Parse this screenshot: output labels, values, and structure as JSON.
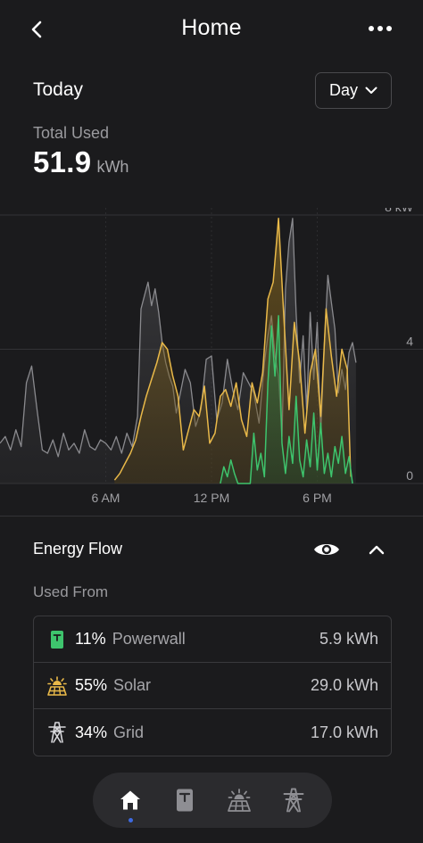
{
  "header": {
    "title": "Home"
  },
  "period": {
    "label": "Today",
    "selector_value": "Day"
  },
  "total": {
    "label": "Total Used",
    "value": "51.9",
    "unit": "kWh"
  },
  "chart_data": {
    "type": "area",
    "x_tick_labels": [
      "6 AM",
      "12 PM",
      "6 PM"
    ],
    "y_tick_labels": [
      "8 kW",
      "4",
      "0"
    ],
    "ylim": [
      0,
      8
    ],
    "xlim_hours": [
      0,
      24
    ],
    "grid": true,
    "colors": {
      "home": "#8a8a8e",
      "solar": "#e9b949",
      "powerwall": "#3ec46d"
    },
    "series": [
      {
        "key": "home",
        "x": [
          0,
          0.3,
          0.6,
          0.9,
          1.2,
          1.5,
          1.8,
          2.1,
          2.4,
          2.7,
          3.0,
          3.3,
          3.6,
          3.9,
          4.2,
          4.5,
          4.8,
          5.1,
          5.4,
          5.7,
          6.0,
          6.3,
          6.6,
          6.9,
          7.2,
          7.5,
          7.8,
          8.0,
          8.2,
          8.4,
          8.6,
          8.8,
          9.0,
          9.2,
          9.4,
          9.6,
          9.8,
          10.0,
          10.2,
          10.5,
          10.8,
          11.1,
          11.4,
          11.7,
          12.0,
          12.3,
          12.6,
          12.9,
          13.2,
          13.5,
          13.8,
          14.1,
          14.4,
          14.7,
          15.0,
          15.2,
          15.4,
          15.6,
          15.8,
          16.0,
          16.2,
          16.4,
          16.6,
          16.8,
          17.0,
          17.2,
          17.4,
          17.6,
          17.8,
          18.0,
          18.2,
          18.4,
          18.6,
          18.8,
          19.0,
          19.2,
          19.4,
          19.6,
          19.8,
          20.0,
          20.2
        ],
        "values": [
          1.2,
          1.4,
          1.0,
          1.6,
          1.1,
          3.0,
          3.5,
          2.2,
          1.0,
          0.9,
          1.3,
          0.8,
          1.5,
          1.0,
          1.2,
          0.9,
          1.6,
          1.1,
          1.0,
          1.3,
          1.2,
          1.0,
          1.4,
          0.9,
          1.5,
          1.1,
          2.0,
          5.2,
          5.6,
          6.0,
          5.3,
          5.8,
          5.1,
          4.2,
          3.6,
          3.2,
          2.9,
          2.1,
          2.6,
          3.4,
          3.0,
          1.7,
          2.2,
          3.7,
          3.8,
          1.9,
          2.4,
          3.7,
          2.8,
          2.2,
          3.3,
          3.0,
          2.7,
          1.8,
          3.6,
          4.4,
          5.0,
          3.8,
          3.2,
          1.4,
          5.8,
          7.2,
          7.9,
          5.1,
          3.0,
          4.4,
          2.2,
          5.1,
          3.1,
          4.8,
          1.5,
          4.1,
          6.2,
          5.4,
          4.6,
          2.7,
          3.4,
          2.8,
          3.9,
          4.2,
          3.6
        ]
      },
      {
        "key": "solar",
        "x": [
          6.5,
          6.8,
          7.1,
          7.4,
          7.7,
          8.0,
          8.3,
          8.6,
          8.9,
          9.2,
          9.5,
          9.8,
          10.1,
          10.4,
          10.7,
          11.0,
          11.3,
          11.6,
          11.9,
          12.2,
          12.5,
          12.8,
          13.1,
          13.4,
          13.7,
          14.0,
          14.3,
          14.6,
          14.9,
          15.2,
          15.5,
          15.8,
          16.1,
          16.4,
          16.7,
          17.0,
          17.3,
          17.6,
          17.9,
          18.2,
          18.5,
          18.8,
          19.1,
          19.4,
          19.7,
          19.9
        ],
        "values": [
          0.1,
          0.3,
          0.6,
          0.9,
          1.3,
          2.0,
          2.6,
          3.1,
          3.6,
          4.2,
          4.0,
          3.2,
          2.6,
          1.0,
          1.6,
          2.2,
          2.0,
          2.9,
          1.2,
          1.5,
          2.6,
          2.8,
          2.3,
          3.0,
          1.9,
          1.4,
          3.0,
          2.4,
          3.3,
          5.5,
          6.0,
          7.9,
          5.0,
          2.2,
          4.8,
          3.6,
          1.5,
          3.3,
          4.0,
          2.0,
          5.2,
          3.8,
          2.6,
          4.0,
          3.4,
          0.2
        ]
      },
      {
        "key": "powerwall",
        "x": [
          12.5,
          12.7,
          12.9,
          13.1,
          13.3,
          13.5,
          14.2,
          14.4,
          14.6,
          14.8,
          15.0,
          15.2,
          15.4,
          15.6,
          15.8,
          16.0,
          16.2,
          16.4,
          16.6,
          16.8,
          17.0,
          17.2,
          17.4,
          17.6,
          17.8,
          18.0,
          18.2,
          18.4,
          18.6,
          18.8,
          19.0,
          19.2,
          19.4,
          19.6,
          19.8,
          20.0
        ],
        "values": [
          0,
          0.5,
          0.2,
          0.7,
          0.3,
          0,
          0,
          1.5,
          0.4,
          0.9,
          0.2,
          3.0,
          4.7,
          3.2,
          5.0,
          1.2,
          0.3,
          1.4,
          0.6,
          2.6,
          0.7,
          0.2,
          1.3,
          0.5,
          2.1,
          0.4,
          1.8,
          0.3,
          0.9,
          0.2,
          1.1,
          0.6,
          1.4,
          0.3,
          0.8,
          0
        ]
      }
    ]
  },
  "energy_flow": {
    "title": "Energy Flow",
    "used_from_label": "Used From",
    "sources": [
      {
        "icon": "powerwall-icon",
        "percent": "11%",
        "name": "Powerwall",
        "kwh": "5.9 kWh"
      },
      {
        "icon": "solar-icon",
        "percent": "55%",
        "name": "Solar",
        "kwh": "29.0 kWh"
      },
      {
        "icon": "grid-tower-icon",
        "percent": "34%",
        "name": "Grid",
        "kwh": "17.0 kWh"
      }
    ]
  },
  "nav": {
    "items": [
      "home-icon",
      "powerwall-icon",
      "solar-icon",
      "grid-tower-icon"
    ],
    "active": "home-icon"
  }
}
